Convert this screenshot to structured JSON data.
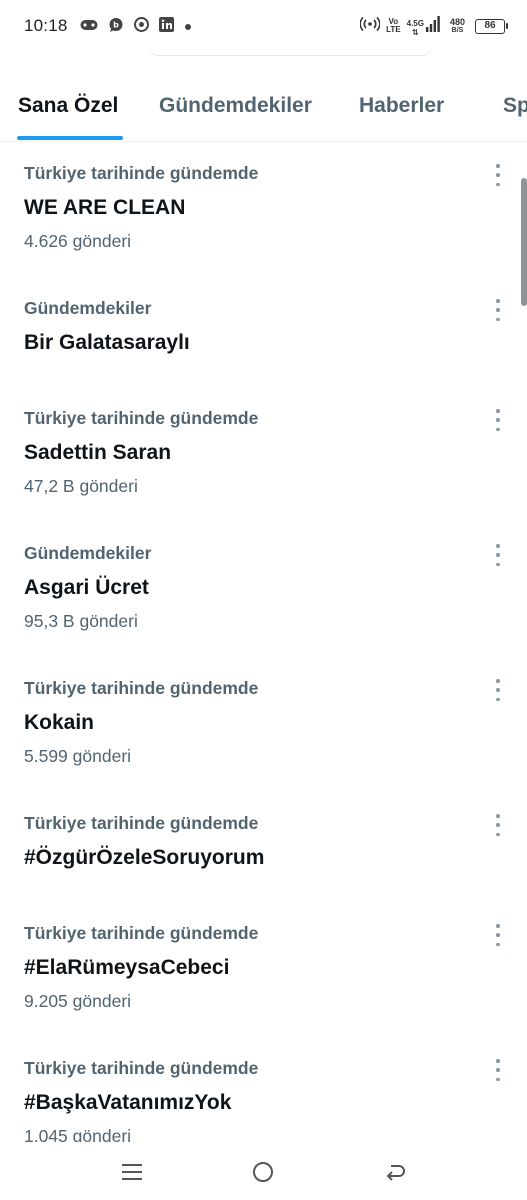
{
  "status_bar": {
    "time": "10:18",
    "notification_icons": [
      "gamepad-icon",
      "chat-bubble-icon",
      "chrome-icon",
      "linkedin-icon",
      "dot-icon"
    ],
    "network_vo": "Vo",
    "network_lte": "LTE",
    "network_type": "4.5G",
    "speed_value": "480",
    "speed_unit": "B/S",
    "battery": "86"
  },
  "tabs": [
    {
      "label": "Sana Özel",
      "active": true
    },
    {
      "label": "Gündemdekiler",
      "active": false
    },
    {
      "label": "Haberler",
      "active": false
    },
    {
      "label": "Spor",
      "active": false
    }
  ],
  "trends": [
    {
      "context": "Türkiye tarihinde gündemde",
      "title": "WE ARE CLEAN",
      "count": "4.626 gönderi"
    },
    {
      "context": "Gündemdekiler",
      "title": "Bir Galatasaraylı",
      "count": ""
    },
    {
      "context": "Türkiye tarihinde gündemde",
      "title": "Sadettin Saran",
      "count": "47,2 B gönderi"
    },
    {
      "context": "Gündemdekiler",
      "title": "Asgari Ücret",
      "count": "95,3 B gönderi"
    },
    {
      "context": "Türkiye tarihinde gündemde",
      "title": "Kokain",
      "count": "5.599 gönderi"
    },
    {
      "context": "Türkiye tarihinde gündemde",
      "title": "#ÖzgürÖzeleSoruyorum",
      "count": ""
    },
    {
      "context": "Türkiye tarihinde gündemde",
      "title": "#ElaRümeysaCebeci",
      "count": "9.205 gönderi"
    },
    {
      "context": "Türkiye tarihinde gündemde",
      "title": "#BaşkaVatanımızYok",
      "count": "1.045 gönderi"
    }
  ],
  "nav_bar": [
    "menu-icon",
    "home-circle-icon",
    "back-icon"
  ],
  "colors": {
    "accent": "#1d9bf0",
    "primary_text": "#0f1419",
    "secondary_text": "#536471"
  }
}
